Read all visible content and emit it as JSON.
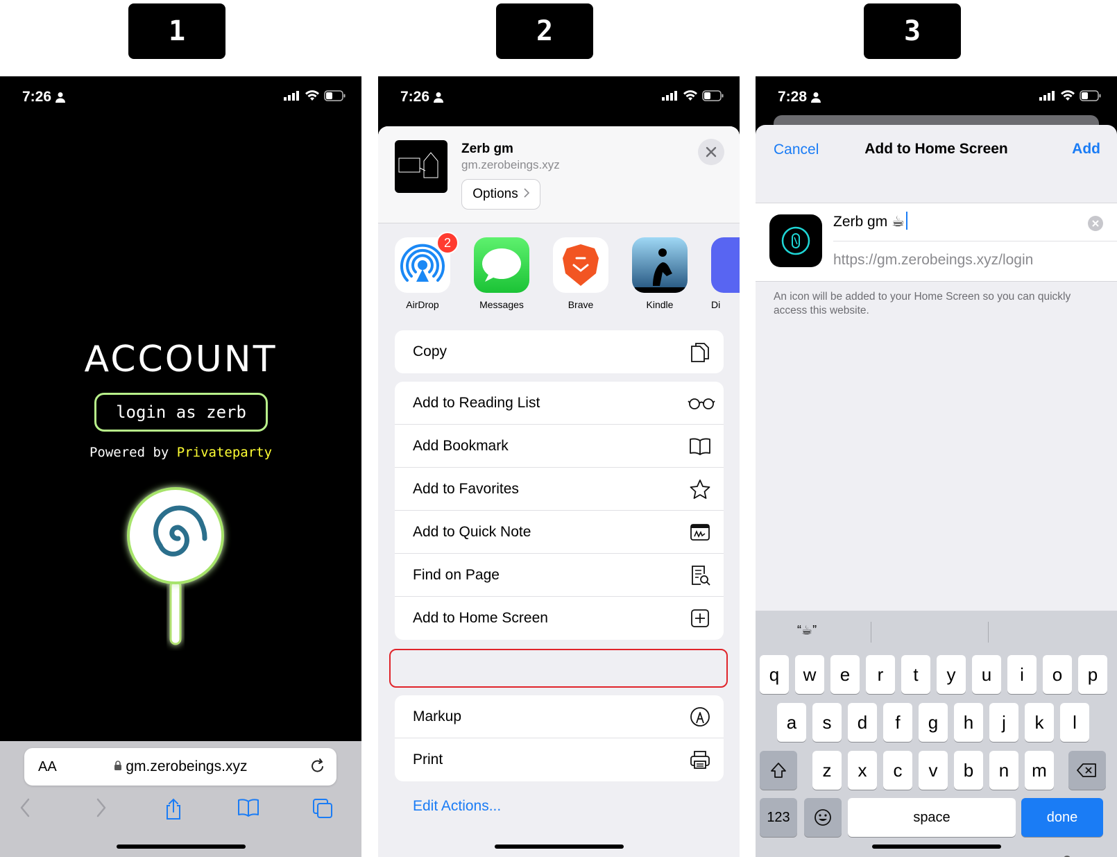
{
  "steps": [
    "1",
    "2",
    "3"
  ],
  "phone1": {
    "time": "7:26",
    "title": "ACCOUNT",
    "login_label": "login as zerb",
    "powered_prefix": "Powered by ",
    "powered_brand": "Privateparty",
    "aa_label": "AA",
    "url": "gm.zerobeings.xyz"
  },
  "phone2": {
    "time": "7:26",
    "site_title": "Zerb gm",
    "site_url": "gm.zerobeings.xyz",
    "options_label": "Options",
    "apps": [
      {
        "label": "AirDrop",
        "badge": "2",
        "icon": "airdrop-icon"
      },
      {
        "label": "Messages",
        "icon": "messages-icon"
      },
      {
        "label": "Brave",
        "icon": "brave-icon"
      },
      {
        "label": "Kindle",
        "icon": "kindle-icon"
      },
      {
        "label": "Di",
        "icon": "discord-icon"
      }
    ],
    "copy_label": "Copy",
    "actions": [
      {
        "label": "Add to Reading List",
        "icon": "glasses-icon"
      },
      {
        "label": "Add Bookmark",
        "icon": "book-icon"
      },
      {
        "label": "Add to Favorites",
        "icon": "star-icon"
      },
      {
        "label": "Add to Quick Note",
        "icon": "quick-note-icon"
      },
      {
        "label": "Find on Page",
        "icon": "find-icon"
      },
      {
        "label": "Add to Home Screen",
        "icon": "plus-square-icon"
      }
    ],
    "more_actions": [
      {
        "label": "Markup",
        "icon": "markup-icon"
      },
      {
        "label": "Print",
        "icon": "printer-icon"
      }
    ],
    "edit_actions": "Edit Actions..."
  },
  "phone3": {
    "time": "7:28",
    "cancel": "Cancel",
    "title": "Add to Home Screen",
    "add": "Add",
    "name_value": "Zerb gm ☕",
    "url_value": "https://gm.zerobeings.xyz/login",
    "info": "An icon will be added to your Home Screen so you can quickly access this website.",
    "suggestion": "“☕”",
    "keyboard": {
      "row1": [
        "q",
        "w",
        "e",
        "r",
        "t",
        "y",
        "u",
        "i",
        "o",
        "p"
      ],
      "row2": [
        "a",
        "s",
        "d",
        "f",
        "g",
        "h",
        "j",
        "k",
        "l"
      ],
      "row3": [
        "z",
        "x",
        "c",
        "v",
        "b",
        "n",
        "m"
      ],
      "numbers": "123",
      "space": "space",
      "done": "done"
    }
  },
  "colors": {
    "ios_blue": "#1a7cf5",
    "highlight_red": "#e0242a",
    "login_border": "#b8f08a",
    "brand_yellow": "#ffff33"
  }
}
